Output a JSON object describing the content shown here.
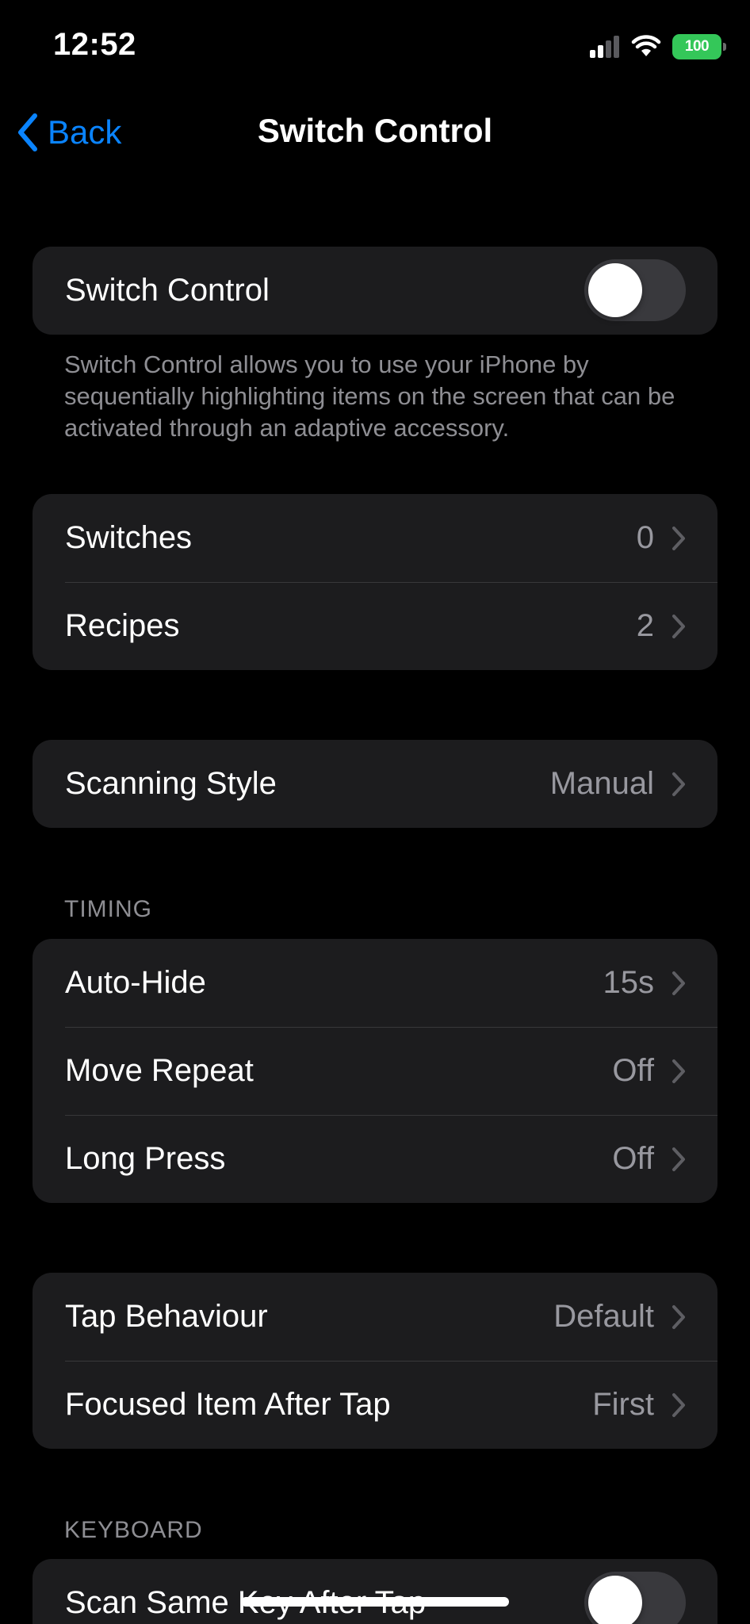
{
  "status_bar": {
    "time": "12:52",
    "battery_level": "100",
    "icons": [
      "signal-icon",
      "wifi-icon",
      "battery-charging-icon"
    ]
  },
  "nav": {
    "back_label": "Back",
    "title": "Switch Control"
  },
  "switch_control_row": {
    "label": "Switch Control",
    "toggle_on": false
  },
  "description": "Switch Control allows you to use your iPhone by sequentially highlighting items on the screen that can be activated through an adaptive accessory.",
  "group_switches": [
    {
      "label": "Switches",
      "value": "0"
    },
    {
      "label": "Recipes",
      "value": "2"
    }
  ],
  "scanning_style": {
    "label": "Scanning Style",
    "value": "Manual"
  },
  "timing": {
    "header": "TIMING",
    "rows": [
      {
        "label": "Auto-Hide",
        "value": "15s"
      },
      {
        "label": "Move Repeat",
        "value": "Off"
      },
      {
        "label": "Long Press",
        "value": "Off"
      }
    ]
  },
  "tap_group": [
    {
      "label": "Tap Behaviour",
      "value": "Default"
    },
    {
      "label": "Focused Item After Tap",
      "value": "First"
    }
  ],
  "keyboard": {
    "header": "KEYBOARD",
    "scan_same_key": {
      "label": "Scan Same Key After Tap",
      "toggle_on": false
    }
  },
  "colors": {
    "accent": "#0a84ff",
    "battery": "#34c759",
    "cell_background": "#1c1c1e",
    "secondary_text": "#98989f"
  }
}
